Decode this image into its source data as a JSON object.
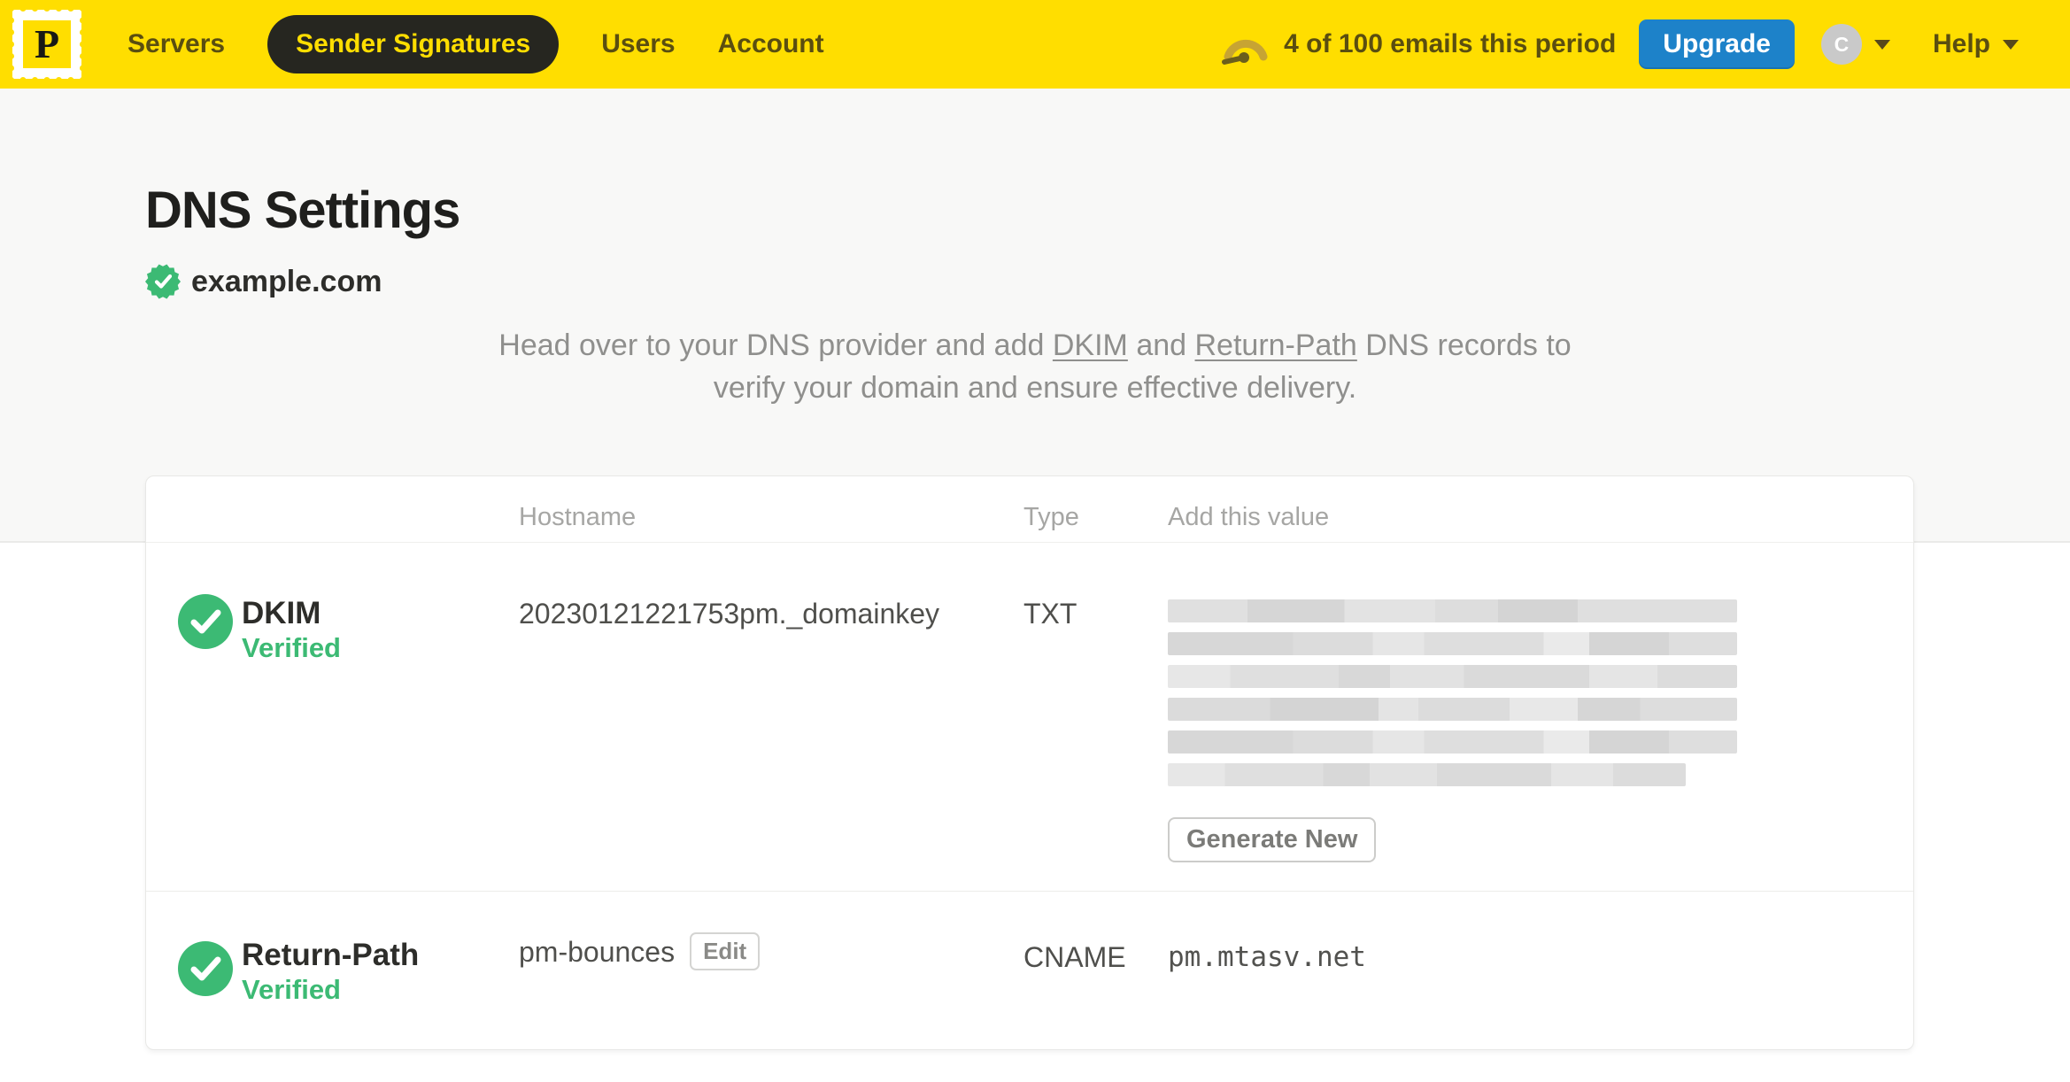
{
  "colors": {
    "brand-yellow": "#FFDE00",
    "nav-text": "#5A4E10",
    "nav-active-bg": "#262620",
    "upgrade-blue": "#1D82C9",
    "verified-green": "#3CBA74",
    "page-bg-top": "#F8F8F7",
    "heading-text": "#1F1F1D",
    "muted-text": "#8F8F8D"
  },
  "navbar": {
    "logo_letter": "P",
    "items": [
      {
        "label": "Servers",
        "active": false
      },
      {
        "label": "Sender Signatures",
        "active": true
      },
      {
        "label": "Users",
        "active": false
      },
      {
        "label": "Account",
        "active": false
      }
    ],
    "usage_text": "4 of 100 emails this period",
    "upgrade_label": "Upgrade",
    "avatar_initial": "C",
    "help_label": "Help"
  },
  "page": {
    "title": "DNS Settings",
    "domain": "example.com",
    "intro": {
      "text_before_dkim": "Head over to your DNS provider and add ",
      "dkim_link": "DKIM",
      "text_between": " and ",
      "return_path_link": "Return-Path",
      "text_after": " DNS records to verify your domain and ensure effective delivery."
    }
  },
  "table": {
    "headers": {
      "hostname": "Hostname",
      "type": "Type",
      "value": "Add this value"
    },
    "rows": [
      {
        "name": "DKIM",
        "status": "Verified",
        "hostname": "20230121221753pm._domainkey",
        "type": "TXT",
        "value_display": "redacted",
        "action_label": "Generate New"
      },
      {
        "name": "Return-Path",
        "status": "Verified",
        "hostname": "pm-bounces",
        "edit_label": "Edit",
        "type": "CNAME",
        "value": "pm.mtasv.net"
      }
    ]
  }
}
